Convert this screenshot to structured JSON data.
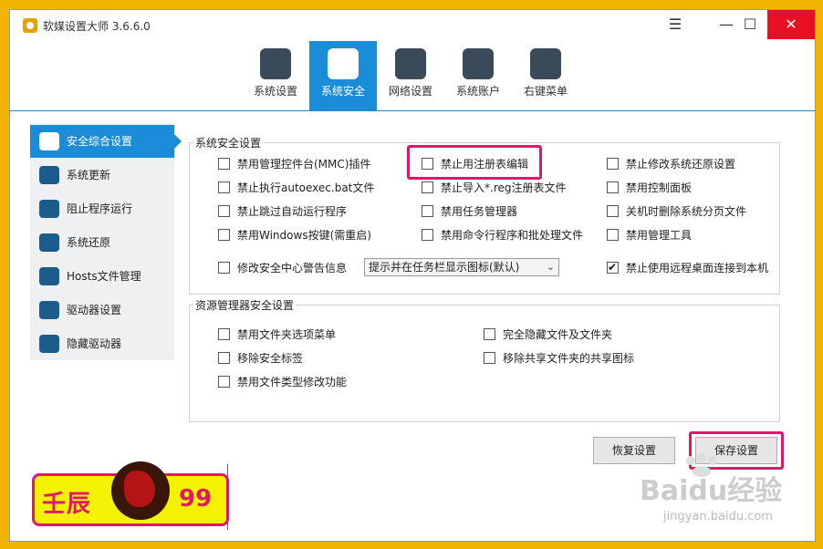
{
  "window": {
    "title": "软媒设置大师 3.6.6.0",
    "menu_icon": "☰",
    "min_icon": "—",
    "max_icon": "☐",
    "close_icon": "✕"
  },
  "toolbar": [
    {
      "label": "系统设置",
      "icon": "monitor-gear-icon"
    },
    {
      "label": "系统安全",
      "icon": "shield-gear-icon"
    },
    {
      "label": "网络设置",
      "icon": "network-icon"
    },
    {
      "label": "系统账户",
      "icon": "users-icon"
    },
    {
      "label": "右键菜单",
      "icon": "context-menu-icon"
    }
  ],
  "sidebar": [
    {
      "label": "安全综合设置",
      "icon": "shield-icon"
    },
    {
      "label": "系统更新",
      "icon": "refresh-icon"
    },
    {
      "label": "阻止程序运行",
      "icon": "block-program-icon"
    },
    {
      "label": "系统还原",
      "icon": "restore-icon"
    },
    {
      "label": "Hosts文件管理",
      "icon": "hosts-icon"
    },
    {
      "label": "驱动器设置",
      "icon": "drive-icon"
    },
    {
      "label": "隐藏驱动器",
      "icon": "hidden-drive-icon"
    }
  ],
  "security": {
    "title": "系统安全设置",
    "col1": [
      {
        "label": "禁用管理控件台(MMC)插件",
        "checked": false
      },
      {
        "label": "禁止执行autoexec.bat文件",
        "checked": false
      },
      {
        "label": "禁止跳过自动运行程序",
        "checked": false
      },
      {
        "label": "禁用Windows按键(需重启)",
        "checked": false
      },
      {
        "label": "修改安全中心警告信息",
        "checked": false
      }
    ],
    "col2": [
      {
        "label": "禁止用注册表编辑",
        "checked": false
      },
      {
        "label": "禁止导入*.reg注册表文件",
        "checked": false
      },
      {
        "label": "禁用任务管理器",
        "checked": false
      },
      {
        "label": "禁用命令行程序和批处理文件",
        "checked": false
      }
    ],
    "col3": [
      {
        "label": "禁止修改系统还原设置",
        "checked": false
      },
      {
        "label": "禁用控制面板",
        "checked": false
      },
      {
        "label": "关机时删除系统分页文件",
        "checked": false
      },
      {
        "label": "禁用管理工具",
        "checked": false
      },
      {
        "label": "禁止使用远程桌面连接到本机",
        "checked": true
      }
    ],
    "select_value": "提示并在任务栏显示图标(默认)"
  },
  "explorer": {
    "title": "资源管理器安全设置",
    "col1": [
      {
        "label": "禁用文件夹选项菜单",
        "checked": false
      },
      {
        "label": "移除安全标签",
        "checked": false
      },
      {
        "label": "禁用文件类型修改功能",
        "checked": false
      }
    ],
    "col2": [
      {
        "label": "完全隐藏文件及文件夹",
        "checked": false
      },
      {
        "label": "移除共享文件夹的共享图标",
        "checked": false
      }
    ]
  },
  "buttons": {
    "restore": "恢复设置",
    "save": "保存设置"
  },
  "highlight_color": "#e0186a",
  "accent_color": "#1a8cd8",
  "watermark": {
    "main": "Baidu经验",
    "sub": "jingyan.baidu.com"
  },
  "logo": {
    "left": "壬辰",
    "right": "99"
  }
}
